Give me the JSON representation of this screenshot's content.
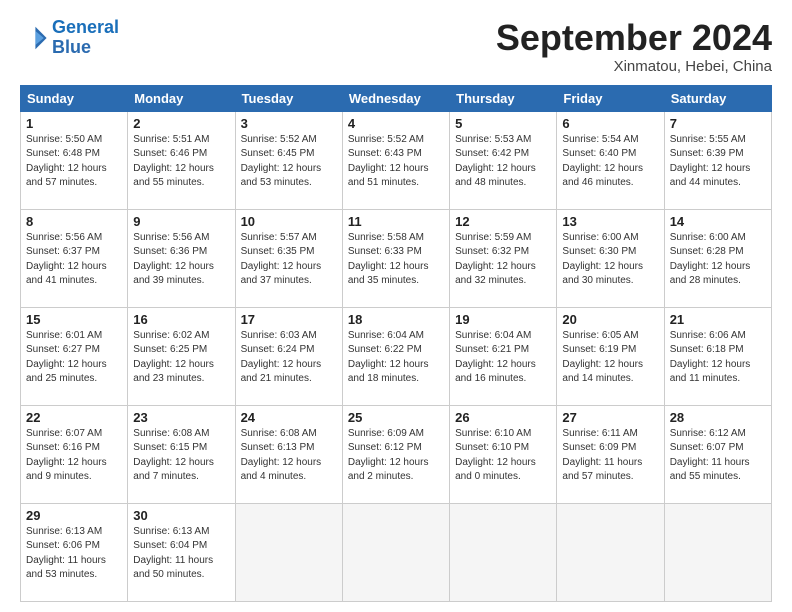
{
  "header": {
    "logo_line1": "General",
    "logo_line2": "Blue",
    "month": "September 2024",
    "location": "Xinmatou, Hebei, China"
  },
  "weekdays": [
    "Sunday",
    "Monday",
    "Tuesday",
    "Wednesday",
    "Thursday",
    "Friday",
    "Saturday"
  ],
  "days": [
    {
      "num": "",
      "detail": ""
    },
    {
      "num": "2",
      "detail": "Sunrise: 5:51 AM\nSunset: 6:46 PM\nDaylight: 12 hours\nand 55 minutes."
    },
    {
      "num": "3",
      "detail": "Sunrise: 5:52 AM\nSunset: 6:45 PM\nDaylight: 12 hours\nand 53 minutes."
    },
    {
      "num": "4",
      "detail": "Sunrise: 5:52 AM\nSunset: 6:43 PM\nDaylight: 12 hours\nand 51 minutes."
    },
    {
      "num": "5",
      "detail": "Sunrise: 5:53 AM\nSunset: 6:42 PM\nDaylight: 12 hours\nand 48 minutes."
    },
    {
      "num": "6",
      "detail": "Sunrise: 5:54 AM\nSunset: 6:40 PM\nDaylight: 12 hours\nand 46 minutes."
    },
    {
      "num": "7",
      "detail": "Sunrise: 5:55 AM\nSunset: 6:39 PM\nDaylight: 12 hours\nand 44 minutes."
    },
    {
      "num": "8",
      "detail": "Sunrise: 5:56 AM\nSunset: 6:37 PM\nDaylight: 12 hours\nand 41 minutes."
    },
    {
      "num": "9",
      "detail": "Sunrise: 5:56 AM\nSunset: 6:36 PM\nDaylight: 12 hours\nand 39 minutes."
    },
    {
      "num": "10",
      "detail": "Sunrise: 5:57 AM\nSunset: 6:35 PM\nDaylight: 12 hours\nand 37 minutes."
    },
    {
      "num": "11",
      "detail": "Sunrise: 5:58 AM\nSunset: 6:33 PM\nDaylight: 12 hours\nand 35 minutes."
    },
    {
      "num": "12",
      "detail": "Sunrise: 5:59 AM\nSunset: 6:32 PM\nDaylight: 12 hours\nand 32 minutes."
    },
    {
      "num": "13",
      "detail": "Sunrise: 6:00 AM\nSunset: 6:30 PM\nDaylight: 12 hours\nand 30 minutes."
    },
    {
      "num": "14",
      "detail": "Sunrise: 6:00 AM\nSunset: 6:28 PM\nDaylight: 12 hours\nand 28 minutes."
    },
    {
      "num": "15",
      "detail": "Sunrise: 6:01 AM\nSunset: 6:27 PM\nDaylight: 12 hours\nand 25 minutes."
    },
    {
      "num": "16",
      "detail": "Sunrise: 6:02 AM\nSunset: 6:25 PM\nDaylight: 12 hours\nand 23 minutes."
    },
    {
      "num": "17",
      "detail": "Sunrise: 6:03 AM\nSunset: 6:24 PM\nDaylight: 12 hours\nand 21 minutes."
    },
    {
      "num": "18",
      "detail": "Sunrise: 6:04 AM\nSunset: 6:22 PM\nDaylight: 12 hours\nand 18 minutes."
    },
    {
      "num": "19",
      "detail": "Sunrise: 6:04 AM\nSunset: 6:21 PM\nDaylight: 12 hours\nand 16 minutes."
    },
    {
      "num": "20",
      "detail": "Sunrise: 6:05 AM\nSunset: 6:19 PM\nDaylight: 12 hours\nand 14 minutes."
    },
    {
      "num": "21",
      "detail": "Sunrise: 6:06 AM\nSunset: 6:18 PM\nDaylight: 12 hours\nand 11 minutes."
    },
    {
      "num": "22",
      "detail": "Sunrise: 6:07 AM\nSunset: 6:16 PM\nDaylight: 12 hours\nand 9 minutes."
    },
    {
      "num": "23",
      "detail": "Sunrise: 6:08 AM\nSunset: 6:15 PM\nDaylight: 12 hours\nand 7 minutes."
    },
    {
      "num": "24",
      "detail": "Sunrise: 6:08 AM\nSunset: 6:13 PM\nDaylight: 12 hours\nand 4 minutes."
    },
    {
      "num": "25",
      "detail": "Sunrise: 6:09 AM\nSunset: 6:12 PM\nDaylight: 12 hours\nand 2 minutes."
    },
    {
      "num": "26",
      "detail": "Sunrise: 6:10 AM\nSunset: 6:10 PM\nDaylight: 12 hours\nand 0 minutes."
    },
    {
      "num": "27",
      "detail": "Sunrise: 6:11 AM\nSunset: 6:09 PM\nDaylight: 11 hours\nand 57 minutes."
    },
    {
      "num": "28",
      "detail": "Sunrise: 6:12 AM\nSunset: 6:07 PM\nDaylight: 11 hours\nand 55 minutes."
    },
    {
      "num": "29",
      "detail": "Sunrise: 6:13 AM\nSunset: 6:06 PM\nDaylight: 11 hours\nand 53 minutes."
    },
    {
      "num": "30",
      "detail": "Sunrise: 6:13 AM\nSunset: 6:04 PM\nDaylight: 11 hours\nand 50 minutes."
    },
    {
      "num": "",
      "detail": ""
    },
    {
      "num": "",
      "detail": ""
    },
    {
      "num": "",
      "detail": ""
    },
    {
      "num": "",
      "detail": ""
    },
    {
      "num": "",
      "detail": ""
    }
  ],
  "first_day_special": {
    "num": "1",
    "detail": "Sunrise: 5:50 AM\nSunset: 6:48 PM\nDaylight: 12 hours\nand 57 minutes."
  }
}
